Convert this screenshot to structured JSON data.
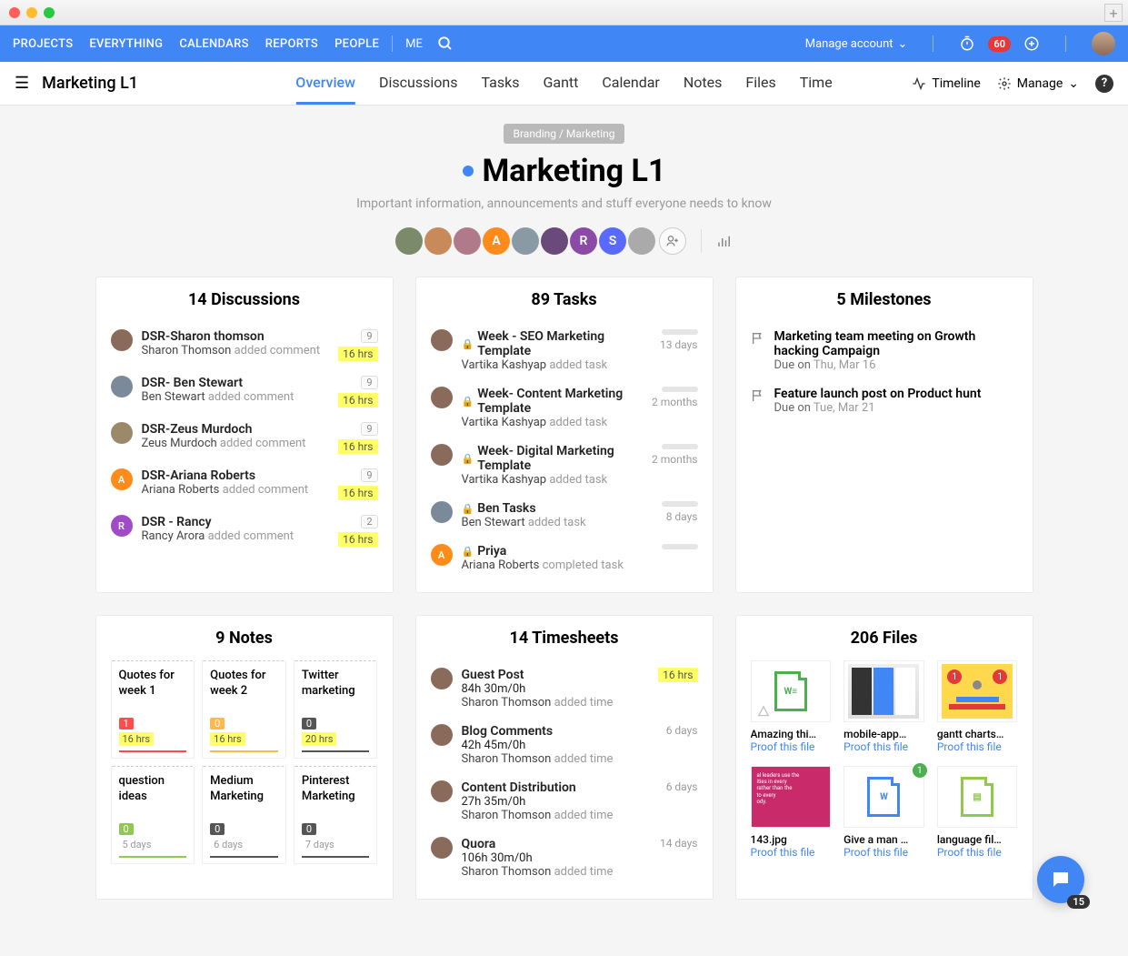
{
  "topnav": {
    "items": [
      "PROJECTS",
      "EVERYTHING",
      "CALENDARS",
      "REPORTS",
      "PEOPLE"
    ],
    "me": "ME",
    "manage_account": "Manage account",
    "notif_count": "60"
  },
  "subnav": {
    "workspace": "Marketing L1",
    "tabs": [
      "Overview",
      "Discussions",
      "Tasks",
      "Gantt",
      "Calendar",
      "Notes",
      "Files",
      "Time"
    ],
    "active_tab": 0,
    "timeline": "Timeline",
    "manage": "Manage"
  },
  "hero": {
    "breadcrumb": "Branding / Marketing",
    "title": "Marketing L1",
    "subtitle": "Important information, announcements and stuff everyone needs to know",
    "members": [
      {
        "type": "img",
        "color": "#7a8a6a"
      },
      {
        "type": "img",
        "color": "#c88a5a"
      },
      {
        "type": "img",
        "color": "#b07a8a"
      },
      {
        "type": "letter",
        "letter": "A",
        "color": "#ff8c1a"
      },
      {
        "type": "img",
        "color": "#8a9aa5"
      },
      {
        "type": "img",
        "color": "#6a4a7a"
      },
      {
        "type": "letter",
        "letter": "R",
        "color": "#8a4aa5"
      },
      {
        "type": "letter",
        "letter": "S",
        "color": "#5a6aff"
      },
      {
        "type": "img",
        "color": "#aaa"
      }
    ]
  },
  "discussions": {
    "title": "14 Discussions",
    "items": [
      {
        "title": "DSR-Sharon thomson",
        "author": "Sharon Thomson",
        "action": "added comment",
        "count": "9",
        "time": "16 hrs",
        "av": "#8a6a5a"
      },
      {
        "title": "DSR- Ben Stewart",
        "author": "Ben Stewart",
        "action": "added comment",
        "count": "9",
        "time": "16 hrs",
        "av": "#7a8a9a"
      },
      {
        "title": "DSR-Zeus Murdoch",
        "author": "Zeus Murdoch",
        "action": "added comment",
        "count": "9",
        "time": "16 hrs",
        "av": "#9a8a6a"
      },
      {
        "title": "DSR-Ariana Roberts",
        "author": "Ariana Roberts",
        "action": "added comment",
        "count": "9",
        "time": "16 hrs",
        "av": "#ff8c1a",
        "letter": "A"
      },
      {
        "title": "DSR - Rancy",
        "author": "Rancy Arora",
        "action": "added comment",
        "count": "2",
        "time": "16 hrs",
        "av": "#a04ac8",
        "letter": "R"
      }
    ]
  },
  "tasks": {
    "title": "89 Tasks",
    "items": [
      {
        "title": "Week - SEO Marketing Template",
        "author": "Vartika Kashyap",
        "action": "added task",
        "time": "13 days",
        "av": "#8a6a5a",
        "locked": true
      },
      {
        "title": "Week- Content Marketing Template",
        "author": "Vartika Kashyap",
        "action": "added task",
        "time": "2 months",
        "av": "#8a6a5a",
        "locked": true
      },
      {
        "title": "Week- Digital Marketing Template",
        "author": "Vartika Kashyap",
        "action": "added task",
        "time": "2 months",
        "av": "#8a6a5a",
        "locked": true
      },
      {
        "title": "Ben Tasks",
        "author": "Ben Stewart",
        "action": "added task",
        "time": "8 days",
        "av": "#7a8a9a",
        "locked": true
      },
      {
        "title": "Priya",
        "author": "Ariana Roberts",
        "action": "completed task",
        "time": "",
        "av": "#ff8c1a",
        "letter": "A",
        "locked": true
      }
    ]
  },
  "milestones": {
    "title": "5 Milestones",
    "items": [
      {
        "title": "Marketing team meeting on Growth hacking Campaign",
        "due_label": "Due on",
        "date": "Thu, Mar 16"
      },
      {
        "title": "Feature launch post on Product hunt",
        "due_label": "Due on",
        "date": "Tue, Mar 21"
      }
    ]
  },
  "notes": {
    "title": "9 Notes",
    "items": [
      {
        "title": "Quotes for week 1",
        "count": "1",
        "count_color": "#ff4d4d",
        "time": "16 hrs",
        "bar": "#ff4d4d"
      },
      {
        "title": "Quotes for week 2",
        "count": "0",
        "count_color": "#ffb84d",
        "time": "16 hrs",
        "bar": "#ffb84d"
      },
      {
        "title": "Twitter marketing",
        "count": "0",
        "count_color": "#555",
        "time": "20 hrs",
        "bar": "#555"
      },
      {
        "title": "question ideas",
        "count": "0",
        "count_color": "#8fc94d",
        "days": "5 days",
        "bar": "#8fc94d"
      },
      {
        "title": "Medium Marketing",
        "count": "0",
        "count_color": "#555",
        "days": "6 days",
        "bar": "#555"
      },
      {
        "title": "Pinterest Marketing",
        "count": "0",
        "count_color": "#555",
        "days": "7 days",
        "bar": "#555"
      }
    ]
  },
  "timesheets": {
    "title": "14 Timesheets",
    "items": [
      {
        "title": "Guest Post",
        "hours": "84h 30m/0h",
        "author": "Sharon Thomson",
        "action": "added time",
        "time": "16 hrs",
        "hl": true,
        "av": "#8a6a5a"
      },
      {
        "title": "Blog Comments",
        "hours": "42h 45m/0h",
        "author": "Sharon Thomson",
        "action": "added time",
        "time": "6 days",
        "av": "#8a6a5a"
      },
      {
        "title": "Content Distribution",
        "hours": "27h 35m/0h",
        "author": "Sharon Thomson",
        "action": "added time",
        "time": "6 days",
        "av": "#8a6a5a"
      },
      {
        "title": "Quora",
        "hours": "106h 30m/0h",
        "author": "Sharon Thomson",
        "action": "added time",
        "time": "14 days",
        "av": "#8a6a5a"
      }
    ]
  },
  "files": {
    "title": "206 Files",
    "proof": "Proof this file",
    "items": [
      {
        "name": "Amazing thi…",
        "type": "word"
      },
      {
        "name": "mobile-app…",
        "type": "mobile"
      },
      {
        "name": "gantt charts…",
        "type": "gantt"
      },
      {
        "name": "143.jpg",
        "type": "pink"
      },
      {
        "name": "Give a man …",
        "type": "docblue",
        "badge": "1"
      },
      {
        "name": "language fil…",
        "type": "docgreen"
      }
    ]
  },
  "fab_badge": "15"
}
